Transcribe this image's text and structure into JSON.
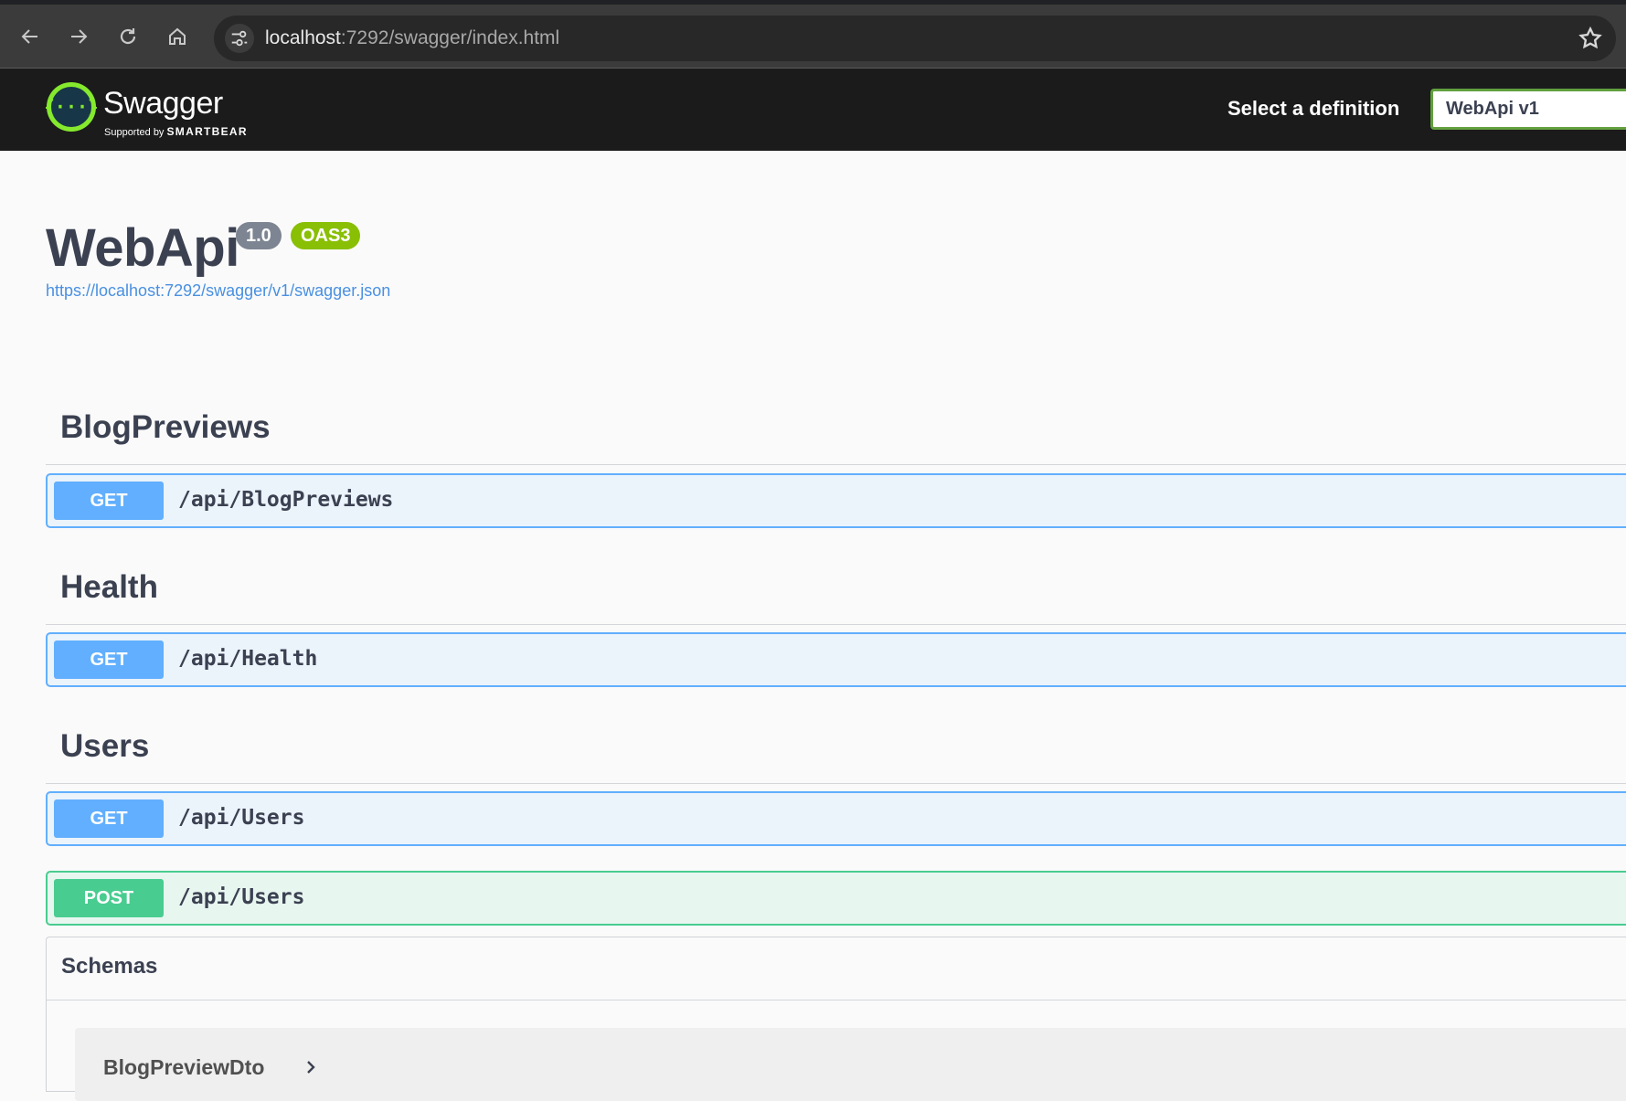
{
  "browser": {
    "url_host": "localhost",
    "url_rest": ":7292/swagger/index.html"
  },
  "topbar": {
    "logo_title": "Swagger",
    "logo_supported": "Supported by",
    "logo_brand": "SMARTBEAR",
    "definition_label": "Select a definition",
    "definition_selected": "WebApi v1"
  },
  "info": {
    "title": "WebApi",
    "version": "1.0",
    "oas": "OAS3",
    "spec_url": "https://localhost:7292/swagger/v1/swagger.json"
  },
  "tags": [
    {
      "name": "BlogPreviews",
      "operations": [
        {
          "method": "GET",
          "path": "/api/BlogPreviews"
        }
      ]
    },
    {
      "name": "Health",
      "operations": [
        {
          "method": "GET",
          "path": "/api/Health"
        }
      ]
    },
    {
      "name": "Users",
      "operations": [
        {
          "method": "GET",
          "path": "/api/Users"
        },
        {
          "method": "POST",
          "path": "/api/Users"
        }
      ]
    }
  ],
  "schemas": {
    "title": "Schemas",
    "models": [
      "BlogPreviewDto"
    ]
  },
  "colors": {
    "get": "#61affe",
    "post": "#49cc90",
    "brand": "#85ea2d"
  }
}
